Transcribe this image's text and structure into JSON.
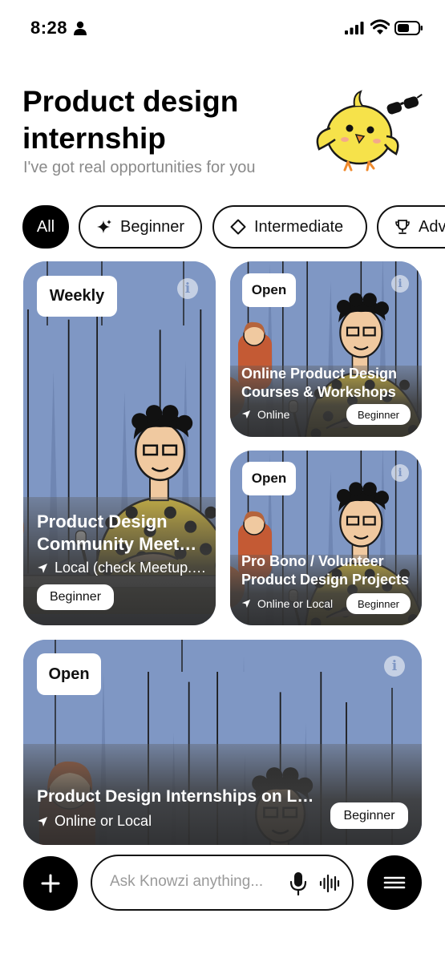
{
  "status_bar": {
    "time": "8:28",
    "icons": [
      "person-icon",
      "signal-icon",
      "wifi-icon",
      "battery-icon"
    ]
  },
  "header": {
    "title": "Product design internship",
    "subtitle": "I've got real opportunities for you",
    "mascot": "mascot-chick-with-sunglasses"
  },
  "filters": {
    "items": [
      {
        "label": "All",
        "icon": "",
        "selected": true
      },
      {
        "label": "Beginner",
        "icon": "sparkle-icon",
        "selected": false
      },
      {
        "label": "Intermediate",
        "icon": "diamond-icon",
        "selected": false
      },
      {
        "label": "Advanced",
        "icon": "trophy-icon",
        "selected": false
      }
    ]
  },
  "cards": [
    {
      "status": "Weekly",
      "title_line1": "Product Design",
      "title_line2": "Community Meetups",
      "location": "Local (check Meetup.com)",
      "level": "Beginner"
    },
    {
      "status": "Open",
      "title": "Online Product Design Courses & Workshops",
      "location": "Online",
      "level": "Beginner"
    },
    {
      "status": "Open",
      "title_line1": "Pro Bono / Volunteer",
      "title_line2": "Product Design Projects",
      "location": "Online or Local",
      "level": "Beginner"
    },
    {
      "status": "Open",
      "title": "Product Design Internships on LinkedIn",
      "location": "Online or Local",
      "level": "Beginner"
    }
  ],
  "bottom_bar": {
    "add_icon": "plus-icon",
    "ask_placeholder": "Ask Knowzi anything...",
    "mic_icon": "microphone-icon",
    "voice_icon": "voice-wave-icon",
    "menu_icon": "menu-icon"
  },
  "colors": {
    "accent": "#000000",
    "card_sky": "#7f97c4",
    "subtitle": "#8a8a8a"
  }
}
